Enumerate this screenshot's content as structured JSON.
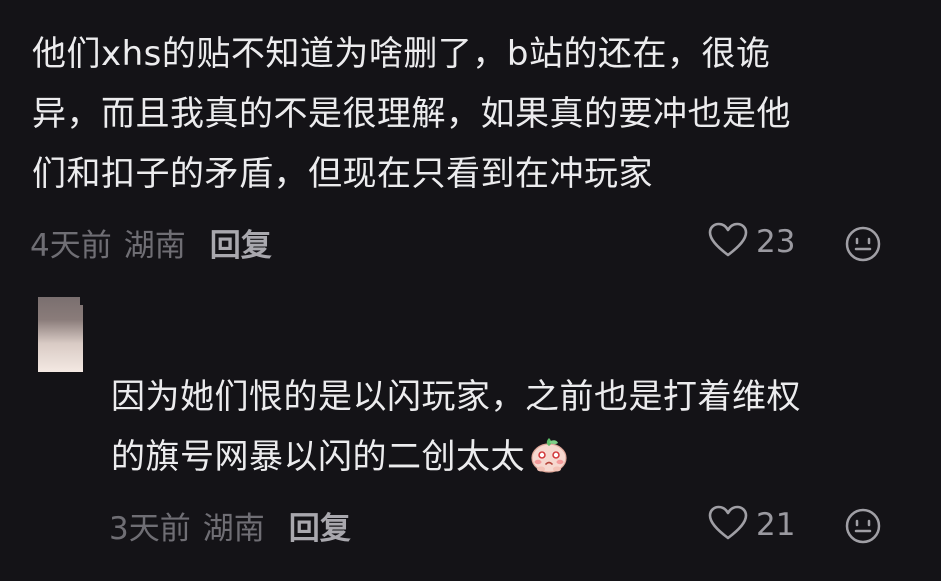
{
  "comments": [
    {
      "text": "他们xhs的贴不知道为啥删了，b站的还在，很诡\n异，而且我真的不是很理解，如果真的要冲也是他\n们和扣子的矛盾，但现在只看到在冲玩家",
      "time": "4天前",
      "location": "湖南",
      "reply_label": "回复",
      "likes": "23"
    },
    {
      "text": "因为她们恨的是以闪玩家，之前也是打着维权\n的旗号网暴以闪的二创太太",
      "time": "3天前",
      "location": "湖南",
      "reply_label": "回复",
      "likes": "21"
    }
  ],
  "icons": {
    "like": "heart-outline-icon",
    "emoji": "smile-face-icon",
    "inline_emoji": "blushing-peach-sticker"
  },
  "colors": {
    "background": "#141317",
    "text_primary": "#ececee",
    "text_meta": "#6f6e74",
    "reply": "#a9a8ae"
  }
}
